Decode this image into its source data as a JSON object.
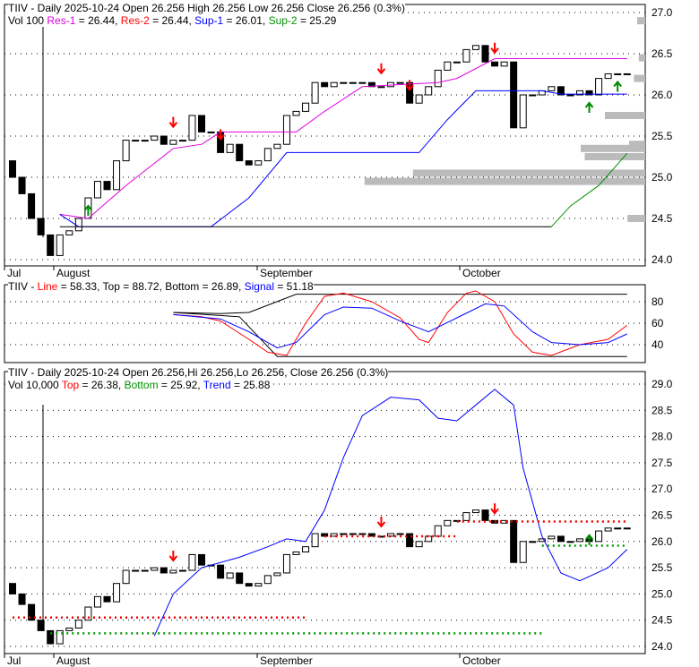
{
  "panel1": {
    "title": "TIIV - Daily 2025-10-24 Open 26.256  High 26.256  Low 26.256  Close 26.256 (0.3%)",
    "vol": "Vol 100",
    "res1": "Res-1",
    "res1_val": " = 26.44, ",
    "res2": "Res-2",
    "res2_val": " = 26.44, ",
    "sup1": "Sup-1",
    "sup1_val": " = 26.01, ",
    "sup2": "Sup-2",
    "sup2_val": " = 25.29"
  },
  "panel2": {
    "ticker": "TIIV - ",
    "line": "Line",
    "line_val": " = 58.33, Top = 88.72, Bottom = 26.89, ",
    "signal": "Signal",
    "signal_val": " = 51.18"
  },
  "panel3": {
    "title": "TIIV - Daily 2025-10-24 Open 26.256,Hi 26.256,Lo 26.256, Close 26.256 (0.3%)",
    "vol": "Vol 10,000 ",
    "top": "Top",
    "top_val": " = 26.38, ",
    "bottom": "Bottom",
    "bottom_val": " = 25.92, ",
    "trend": "Trend",
    "trend_val": " = 25.88"
  },
  "colors": {
    "res1": "#e000e0",
    "sup1": "#0000ff",
    "sup2": "#009000",
    "arrow_down": "#ff0000",
    "arrow_up": "#008000"
  },
  "chart_data": [
    {
      "type": "candlestick",
      "name": "price",
      "closes": [
        25.0,
        24.8,
        24.5,
        24.3,
        24.05,
        24.3,
        24.35,
        24.5,
        24.75,
        24.95,
        24.85,
        25.2,
        25.45,
        25.45,
        25.45,
        25.5,
        25.4,
        25.45,
        25.45,
        25.75,
        25.55,
        25.55,
        25.3,
        25.4,
        25.2,
        25.15,
        25.2,
        25.35,
        25.4,
        25.75,
        25.8,
        25.9,
        26.15,
        26.1,
        26.15,
        26.15,
        26.15,
        26.15,
        26.1,
        26.1,
        26.15,
        26.15,
        25.9,
        26.0,
        26.1,
        26.3,
        26.4,
        26.4,
        26.55,
        26.6,
        26.4,
        26.35,
        26.4,
        25.6,
        26.0,
        26.0,
        26.05,
        26.1,
        26.0,
        26.0,
        26.05,
        26.0,
        26.2,
        26.256,
        26.256,
        26.256
      ],
      "res1": [
        [
          5,
          24.55
        ],
        [
          8,
          24.5
        ],
        [
          12,
          24.9
        ],
        [
          17,
          25.35
        ],
        [
          20,
          25.4
        ],
        [
          22,
          25.55
        ],
        [
          30,
          25.55
        ],
        [
          33,
          25.8
        ],
        [
          37,
          26.1
        ],
        [
          45,
          26.15
        ],
        [
          47,
          26.2
        ],
        [
          51,
          26.44
        ],
        [
          65,
          26.44
        ]
      ],
      "sup1": [
        [
          5,
          24.55
        ],
        [
          7,
          24.4
        ],
        [
          21,
          24.4
        ],
        [
          25,
          24.75
        ],
        [
          29,
          25.3
        ],
        [
          43,
          25.3
        ],
        [
          46,
          25.7
        ],
        [
          49,
          26.05
        ],
        [
          56,
          26.05
        ],
        [
          58,
          26.01
        ],
        [
          65,
          26.01
        ]
      ],
      "base": [
        [
          5,
          24.4
        ],
        [
          57,
          24.4
        ]
      ],
      "sup2": [
        [
          57,
          24.4
        ],
        [
          59,
          24.65
        ],
        [
          62,
          24.9
        ],
        [
          65,
          25.29
        ]
      ],
      "down_arrows": [
        17,
        22,
        39,
        42,
        51
      ],
      "up_arrows": [
        8,
        61,
        64
      ],
      "yticks": [
        24.0,
        24.5,
        25.0,
        25.5,
        26.0,
        26.5,
        27.0
      ],
      "xticks": [
        "Jul",
        "August",
        "September",
        "October"
      ]
    },
    {
      "type": "line",
      "name": "stochastic",
      "line": [
        [
          17,
          68
        ],
        [
          20,
          66
        ],
        [
          22,
          62
        ],
        [
          25,
          45
        ],
        [
          27,
          33
        ],
        [
          29,
          30
        ],
        [
          31,
          60
        ],
        [
          33,
          85
        ],
        [
          35,
          88
        ],
        [
          38,
          80
        ],
        [
          41,
          65
        ],
        [
          43,
          45
        ],
        [
          44,
          42
        ],
        [
          46,
          70
        ],
        [
          48,
          88
        ],
        [
          49,
          90
        ],
        [
          51,
          80
        ],
        [
          53,
          50
        ],
        [
          55,
          33
        ],
        [
          57,
          30
        ],
        [
          60,
          40
        ],
        [
          63,
          45
        ],
        [
          65,
          58
        ]
      ],
      "signal": [
        [
          17,
          68
        ],
        [
          22,
          64
        ],
        [
          25,
          52
        ],
        [
          28,
          37
        ],
        [
          30,
          42
        ],
        [
          33,
          68
        ],
        [
          35,
          75
        ],
        [
          38,
          74
        ],
        [
          41,
          62
        ],
        [
          44,
          52
        ],
        [
          47,
          65
        ],
        [
          50,
          78
        ],
        [
          52,
          76
        ],
        [
          55,
          52
        ],
        [
          57,
          42
        ],
        [
          60,
          40
        ],
        [
          63,
          42
        ],
        [
          65,
          50
        ]
      ],
      "top": [
        [
          17,
          70
        ],
        [
          22,
          69
        ],
        [
          25,
          70
        ],
        [
          30,
          87
        ],
        [
          65,
          87
        ]
      ],
      "bottom": [
        [
          17,
          70
        ],
        [
          24,
          66
        ],
        [
          28,
          29
        ],
        [
          65,
          29
        ]
      ],
      "yticks": [
        40,
        60,
        80
      ]
    },
    {
      "type": "line",
      "name": "trend",
      "trend": [
        [
          15,
          24.2
        ],
        [
          17,
          25.0
        ],
        [
          20,
          25.5
        ],
        [
          24,
          25.7
        ],
        [
          27,
          25.9
        ],
        [
          29,
          26.05
        ],
        [
          31,
          26.0
        ],
        [
          33,
          26.6
        ],
        [
          35,
          27.6
        ],
        [
          37,
          28.4
        ],
        [
          40,
          28.75
        ],
        [
          43,
          28.7
        ],
        [
          45,
          28.35
        ],
        [
          47,
          28.3
        ],
        [
          49,
          28.6
        ],
        [
          51,
          28.9
        ],
        [
          53,
          28.6
        ],
        [
          54,
          27.4
        ],
        [
          56,
          26.1
        ],
        [
          58,
          25.4
        ],
        [
          60,
          25.25
        ],
        [
          63,
          25.5
        ],
        [
          65,
          25.85
        ]
      ],
      "top_segments": [
        [
          [
            0,
            24.55
          ],
          [
            31,
            24.55
          ]
        ],
        [
          [
            33,
            26.1
          ],
          [
            47,
            26.1
          ]
        ],
        [
          [
            47,
            26.38
          ],
          [
            65,
            26.38
          ]
        ]
      ],
      "bottom_segments": [
        [
          [
            4,
            24.25
          ],
          [
            56,
            24.25
          ]
        ],
        [
          [
            56,
            25.92
          ],
          [
            65,
            25.92
          ]
        ]
      ],
      "yticks": [
        24.0,
        24.5,
        25.0,
        25.5,
        26.0,
        26.5,
        27.0,
        27.5,
        28.0,
        28.5,
        29.0
      ]
    }
  ]
}
